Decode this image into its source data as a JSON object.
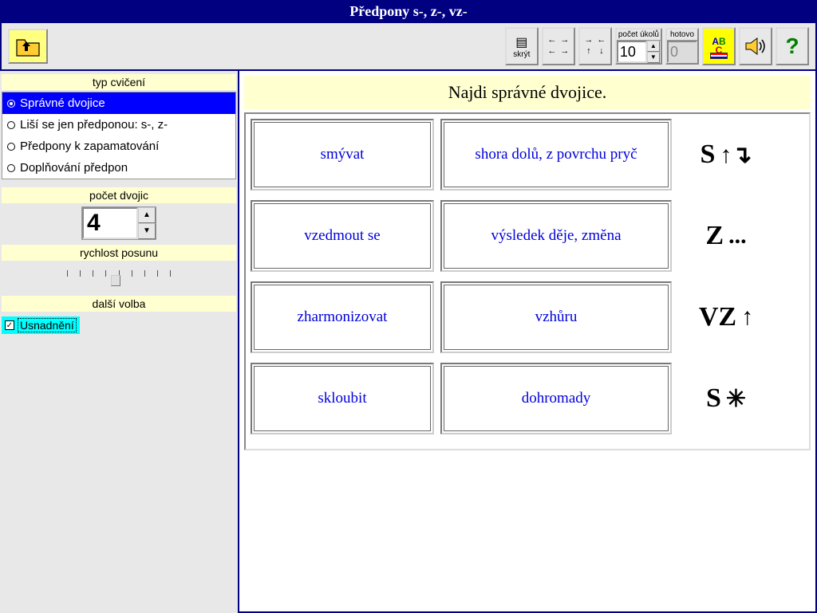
{
  "title": "Předpony s-, z-, vz-",
  "toolbar": {
    "hide_label": "skrýt",
    "tasks_label": "počet úkolů",
    "tasks_value": "10",
    "done_label": "hotovo",
    "done_value": "0"
  },
  "sidebar": {
    "type_header": "typ cvičení",
    "options": [
      {
        "label": "Správné dvojice",
        "selected": true
      },
      {
        "label": "Liší se jen předponou: s-, z-",
        "selected": false
      },
      {
        "label": "Předpony k zapamatování",
        "selected": false
      },
      {
        "label": "Doplňování předpon",
        "selected": false
      }
    ],
    "pairs_header": "počet dvojic",
    "pairs_value": "4",
    "speed_header": "rychlost posunu",
    "other_header": "další volba",
    "ease_label": "Usnadnění"
  },
  "main": {
    "instruction": "Najdi správné dvojice.",
    "rows": [
      {
        "left": "smývat",
        "right": "shora dolů, z povrchu pryč",
        "hint_letter": "S",
        "hint_sym": "↑↴"
      },
      {
        "left": "vzedmout se",
        "right": "výsledek děje, změna",
        "hint_letter": "Z",
        "hint_sym": "..."
      },
      {
        "left": "zharmonizovat",
        "right": "vzhůru",
        "hint_letter": "VZ",
        "hint_sym": "↑"
      },
      {
        "left": "skloubit",
        "right": "dohromady",
        "hint_letter": "S",
        "hint_sym": "✳"
      }
    ]
  }
}
